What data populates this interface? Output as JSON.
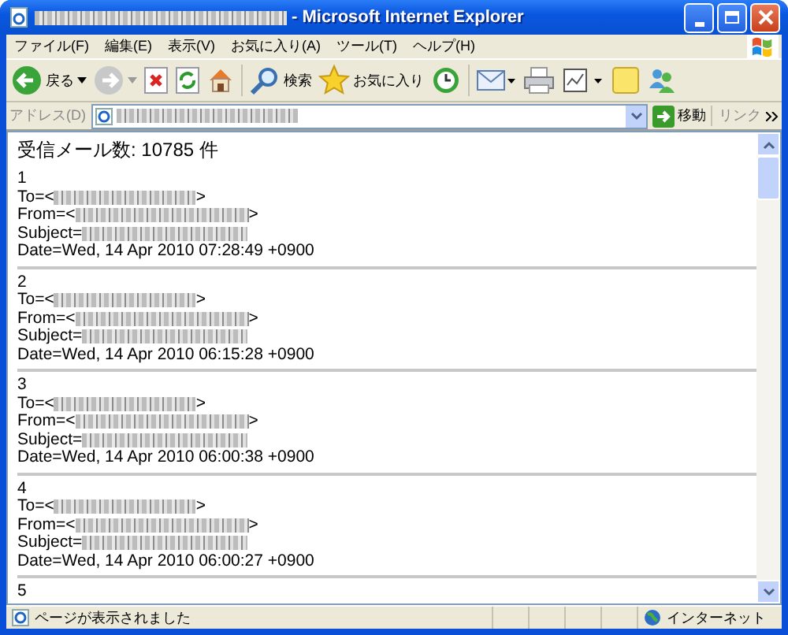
{
  "window": {
    "title_suffix": " - Microsoft Internet Explorer"
  },
  "menu": [
    "ファイル(F)",
    "編集(E)",
    "表示(V)",
    "お気に入り(A)",
    "ツール(T)",
    "ヘルプ(H)"
  ],
  "toolbar": [
    {
      "kind": "back",
      "label": "戻る"
    },
    {
      "kind": "forward"
    },
    {
      "kind": "stop"
    },
    {
      "kind": "refresh"
    },
    {
      "kind": "home"
    },
    {
      "kind": "sep"
    },
    {
      "kind": "search",
      "label": "検索"
    },
    {
      "kind": "favorites",
      "label": "お気に入り"
    },
    {
      "kind": "history"
    },
    {
      "kind": "sep"
    },
    {
      "kind": "mail"
    },
    {
      "kind": "print"
    },
    {
      "kind": "edit"
    },
    {
      "kind": "note"
    },
    {
      "kind": "messenger"
    }
  ],
  "address_bar": {
    "label": "アドレス(D)",
    "go": "移動",
    "links": "リンク"
  },
  "page": {
    "count_text": "受信メール数: 10785 件",
    "emails": [
      {
        "number": "1",
        "fields": [
          {
            "prefix": "To=<",
            "suffix": ">"
          },
          {
            "prefix": "From=<",
            "suffix": ">"
          },
          {
            "prefix": "Subject="
          }
        ],
        "date": "Date=Wed, 14 Apr 2010 07:28:49 +0900"
      },
      {
        "number": "2",
        "fields": [
          {
            "prefix": "To=<",
            "suffix": ">"
          },
          {
            "prefix": "From=<",
            "suffix": ">"
          },
          {
            "prefix": "Subject="
          }
        ],
        "date": "Date=Wed, 14 Apr 2010 06:15:28 +0900"
      },
      {
        "number": "3",
        "fields": [
          {
            "prefix": "To=<",
            "suffix": ">"
          },
          {
            "prefix": "From=<",
            "suffix": ">"
          },
          {
            "prefix": "Subject="
          }
        ],
        "date": "Date=Wed, 14 Apr 2010 06:00:38 +0900"
      },
      {
        "number": "4",
        "fields": [
          {
            "prefix": "To=<",
            "suffix": ">"
          },
          {
            "prefix": "From=<",
            "suffix": ">"
          },
          {
            "prefix": "Subject="
          }
        ],
        "date": "Date=Wed, 14 Apr 2010 06:00:27 +0900"
      },
      {
        "number": "5"
      }
    ]
  },
  "status_bar": {
    "text": "ページが表示されました",
    "zone": "インターネット"
  }
}
